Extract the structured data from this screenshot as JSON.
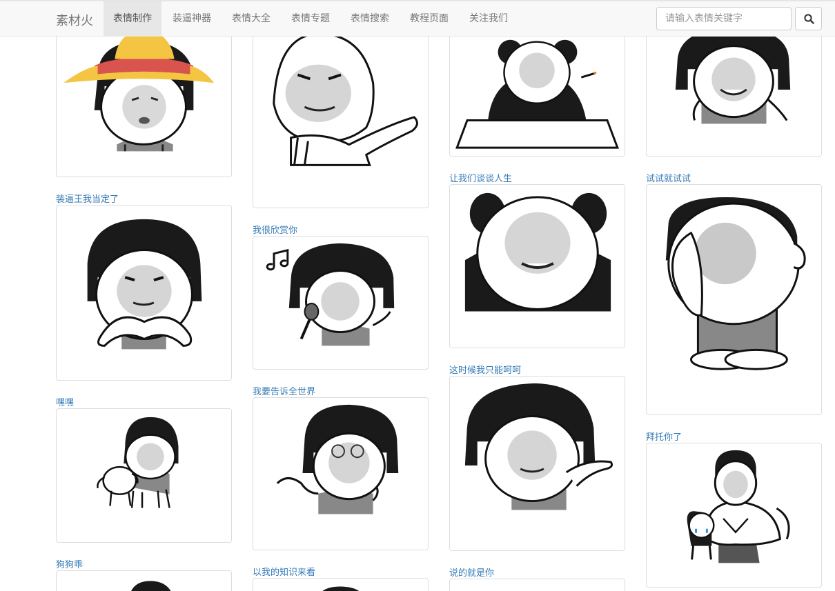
{
  "navbar": {
    "brand": "素材火",
    "items": [
      "表情制作",
      "装逼神器",
      "表情大全",
      "表情专题",
      "表情搜索",
      "教程页面",
      "关注我们"
    ],
    "active_index": 0,
    "search_placeholder": "请输入表情关键字",
    "search_icon": "search-icon"
  },
  "memes": {
    "col1": [
      "装逼王我当定了",
      "嘿嘿",
      "狗狗乖"
    ],
    "col2": [
      "我很欣赏你",
      "我要告诉全世界",
      "以我的知识来看"
    ],
    "col3": [
      "让我们谈谈人生",
      "这时候我只能呵呵",
      "说的就是你"
    ],
    "col4": [
      "试试就试试",
      "拜托你了"
    ]
  },
  "colors": {
    "caption": "#337ab7",
    "navbar_bg": "#f8f8f8",
    "active_bg": "#e7e7e7"
  }
}
